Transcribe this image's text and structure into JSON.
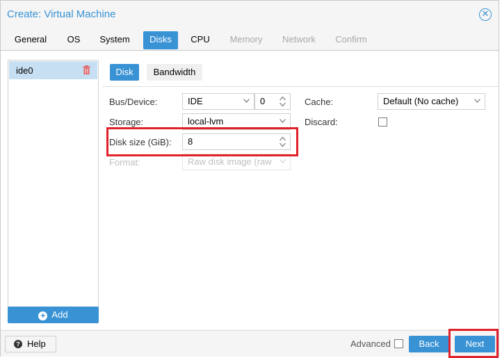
{
  "window": {
    "title": "Create: Virtual Machine"
  },
  "tabs": [
    {
      "label": "General",
      "state": "normal"
    },
    {
      "label": "OS",
      "state": "normal"
    },
    {
      "label": "System",
      "state": "normal"
    },
    {
      "label": "Disks",
      "state": "active"
    },
    {
      "label": "CPU",
      "state": "normal"
    },
    {
      "label": "Memory",
      "state": "disabled"
    },
    {
      "label": "Network",
      "state": "disabled"
    },
    {
      "label": "Confirm",
      "state": "disabled"
    }
  ],
  "disk_list": {
    "items": [
      {
        "label": "ide0",
        "icon": "trash-icon"
      }
    ],
    "add_label": "Add"
  },
  "subtabs": {
    "disk": "Disk",
    "bandwidth": "Bandwidth"
  },
  "form": {
    "bus_device": {
      "label": "Bus/Device:",
      "bus": "IDE",
      "device": "0"
    },
    "storage": {
      "label": "Storage:",
      "value": "local-lvm"
    },
    "disk_size": {
      "label": "Disk size (GiB):",
      "value": "8"
    },
    "format": {
      "label": "Format:",
      "value": "Raw disk image (raw"
    },
    "cache": {
      "label": "Cache:",
      "value": "Default (No cache)"
    },
    "discard": {
      "label": "Discard:",
      "checked": false
    }
  },
  "footer": {
    "help_label": "Help",
    "advanced_label": "Advanced",
    "advanced_checked": false,
    "back_label": "Back",
    "next_label": "Next"
  },
  "colors": {
    "accent": "#3892d4",
    "highlight": "#e0202a",
    "selected_row": "#c7dff2"
  }
}
